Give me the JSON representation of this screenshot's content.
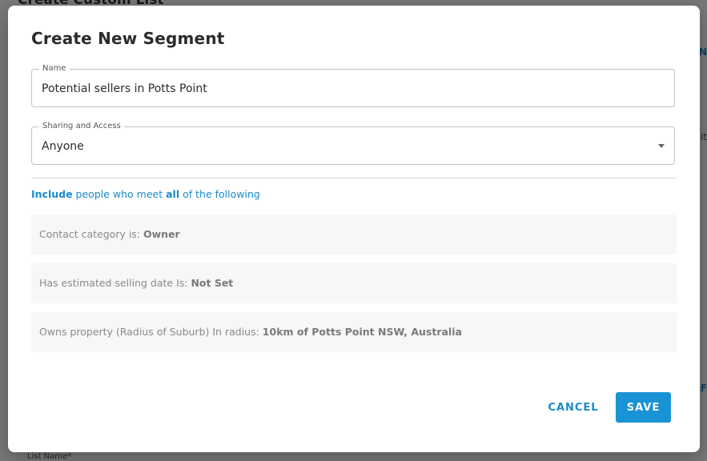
{
  "background": {
    "title": "Create Custom List",
    "list_name_label": "List Name*",
    "right_fragment_1": "N",
    "right_fragment_2": "it",
    "right_fragment_3": "F"
  },
  "modal": {
    "title": "Create New Segment",
    "name_field": {
      "label": "Name",
      "value": "Potential sellers in Potts Point"
    },
    "sharing_field": {
      "label": "Sharing and Access",
      "value": "Anyone"
    },
    "include_line": {
      "prefix_bold": "Include",
      "middle": " people who meet ",
      "bold_word": "all",
      "suffix": " of the following"
    },
    "rules": [
      {
        "label": "Contact category is: ",
        "value": "Owner"
      },
      {
        "label": "Has estimated selling date Is: ",
        "value": "Not Set"
      },
      {
        "label": "Owns property (Radius of Suburb) In radius: ",
        "value": "10km of Potts Point NSW, Australia"
      }
    ],
    "cancel_label": "CANCEL",
    "save_label": "SAVE"
  },
  "colors": {
    "accent": "#1a93d4",
    "link": "#1a8bc9"
  }
}
